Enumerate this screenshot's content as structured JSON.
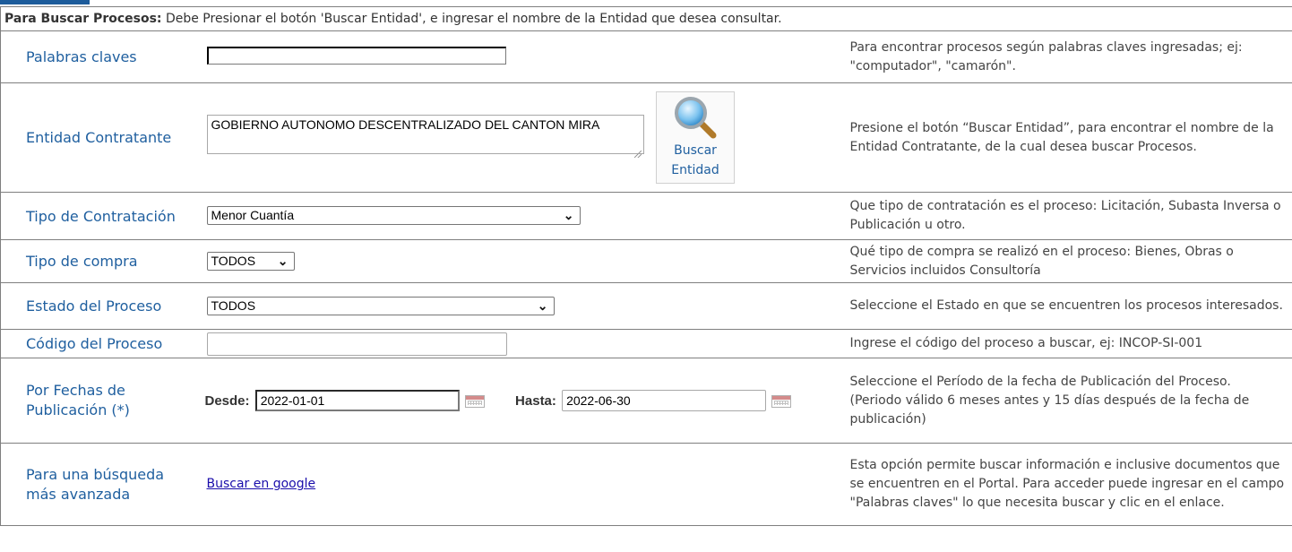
{
  "instruction": {
    "prefix": "Para Buscar Procesos:",
    "text": " Debe Presionar el botón 'Buscar Entidad', e ingresar el nombre de la Entidad que desea consultar."
  },
  "fields": {
    "keywords": {
      "label": "Palabras claves",
      "value": "",
      "help": "Para encontrar procesos según palabras claves ingresadas; ej: \"computador\", \"camarón\"."
    },
    "entity": {
      "label": "Entidad Contratante",
      "value": "GOBIERNO AUTONOMO DESCENTRALIZADO DEL CANTON MIRA",
      "button_line1": "Buscar",
      "button_line2": "Entidad",
      "help": "Presione el botón “Buscar Entidad”, para encontrar el nombre de la Entidad Contratante, de la cual desea buscar Procesos."
    },
    "contract_type": {
      "label": "Tipo de Contratación",
      "selected": "Menor Cuantía",
      "help": "Que tipo de contratación es el proceso: Licitación, Subasta Inversa o Publicación u otro."
    },
    "purchase_type": {
      "label": "Tipo de compra",
      "selected": "TODOS",
      "help": "Qué tipo de compra se realizó en el proceso: Bienes, Obras o Servicios incluidos Consultoría"
    },
    "process_state": {
      "label": "Estado del Proceso",
      "selected": "TODOS",
      "help": "Seleccione el Estado en que se encuentren los procesos interesados."
    },
    "process_code": {
      "label": "Código del Proceso",
      "value": "",
      "help": "Ingrese el código del proceso a buscar, ej: INCOP-SI-001"
    },
    "dates": {
      "label_line1": "Por Fechas de",
      "label_line2": "Publicación (*)",
      "from_label": "Desde:",
      "from_value": "2022-01-01",
      "to_label": "Hasta:",
      "to_value": "2022-06-30",
      "help_line1": "Seleccione el Período de la fecha de Publicación del Proceso.",
      "help_line2": "(Periodo válido 6 meses antes y 15 días después de la fecha de publicación)"
    },
    "advanced": {
      "label_line1": "Para una búsqueda",
      "label_line2": "más avanzada",
      "link": "Buscar en google",
      "help": "Esta opción permite buscar información e inclusive documentos que se encuentren en el Portal. Para acceder puede ingresar en el campo \"Palabras claves\" lo que necesita buscar y clic en el enlace."
    }
  }
}
